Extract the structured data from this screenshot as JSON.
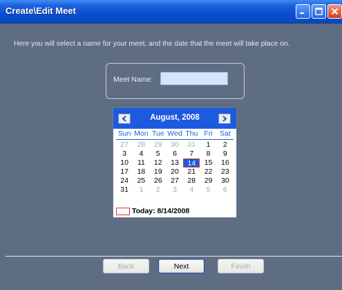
{
  "window": {
    "title": "Create\\Edit Meet"
  },
  "intro_text": "Here you will select a name for your meet, and the date that the meet will take place on.",
  "meet_name": {
    "label": "Meet Name:",
    "value": ""
  },
  "calendar": {
    "month_title": "August, 2008",
    "days_of_week": [
      "Sun",
      "Mon",
      "Tue",
      "Wed",
      "Thu",
      "Fri",
      "Sat"
    ],
    "weeks": [
      [
        {
          "d": "27",
          "o": true
        },
        {
          "d": "28",
          "o": true
        },
        {
          "d": "29",
          "o": true
        },
        {
          "d": "30",
          "o": true
        },
        {
          "d": "31",
          "o": true
        },
        {
          "d": "1"
        },
        {
          "d": "2"
        }
      ],
      [
        {
          "d": "3"
        },
        {
          "d": "4"
        },
        {
          "d": "5"
        },
        {
          "d": "6"
        },
        {
          "d": "7"
        },
        {
          "d": "8"
        },
        {
          "d": "9"
        }
      ],
      [
        {
          "d": "10"
        },
        {
          "d": "11"
        },
        {
          "d": "12"
        },
        {
          "d": "13"
        },
        {
          "d": "14",
          "s": true
        },
        {
          "d": "15"
        },
        {
          "d": "16"
        }
      ],
      [
        {
          "d": "17"
        },
        {
          "d": "18"
        },
        {
          "d": "19"
        },
        {
          "d": "20"
        },
        {
          "d": "21"
        },
        {
          "d": "22"
        },
        {
          "d": "23"
        }
      ],
      [
        {
          "d": "24"
        },
        {
          "d": "25"
        },
        {
          "d": "26"
        },
        {
          "d": "27"
        },
        {
          "d": "28"
        },
        {
          "d": "29"
        },
        {
          "d": "30"
        }
      ],
      [
        {
          "d": "31"
        },
        {
          "d": "1",
          "o": true
        },
        {
          "d": "2",
          "o": true
        },
        {
          "d": "3",
          "o": true
        },
        {
          "d": "4",
          "o": true
        },
        {
          "d": "5",
          "o": true
        },
        {
          "d": "6",
          "o": true
        }
      ]
    ],
    "selected_date": "14",
    "today_label": "Today: 8/14/2008"
  },
  "buttons": {
    "back": "Back",
    "next": "Next",
    "finish": "Finish"
  },
  "colors": {
    "titlebar": "#0a4fd0",
    "background": "#5f6d83",
    "calendar_accent": "#1c5ae0",
    "today_marker": "#d23a2a"
  }
}
